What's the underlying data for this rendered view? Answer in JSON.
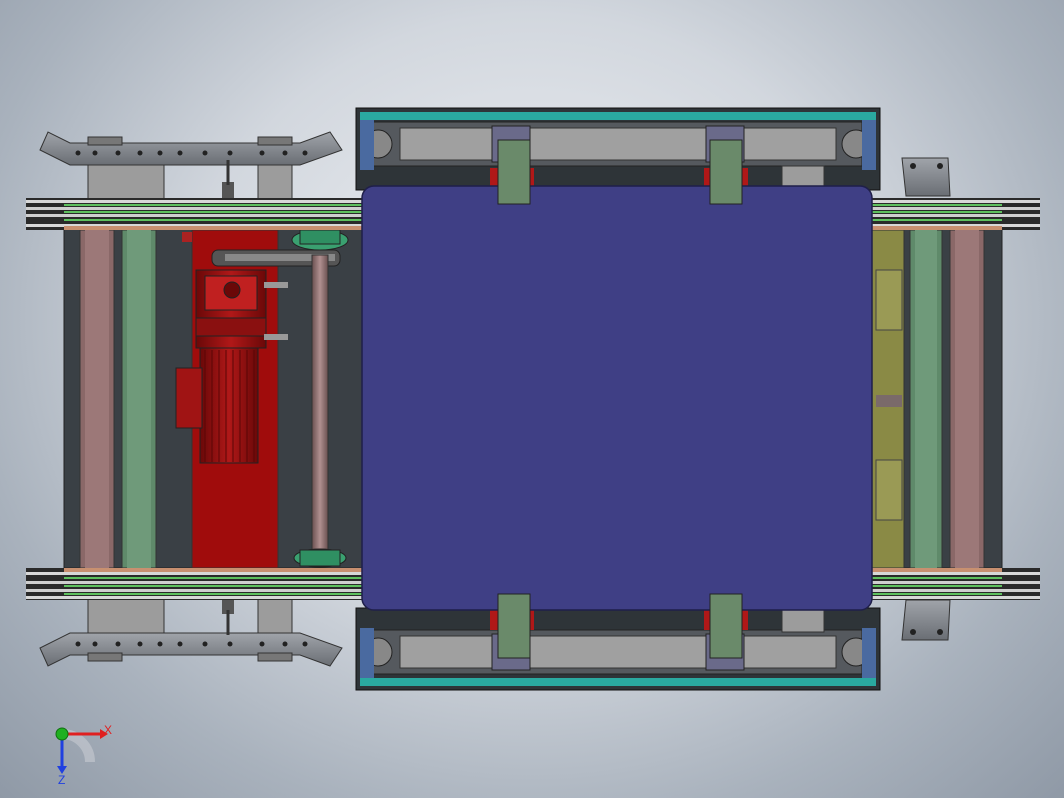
{
  "triad": {
    "x_label": "X",
    "z_label": "Z",
    "x_color": "#e02020",
    "y_color": "#20b020",
    "z_color": "#2040e0"
  },
  "colors": {
    "platform": "#3f3f85",
    "motor": "#9a0f0f",
    "gearbox": "#a01414",
    "rail_green": "#5f8a6a",
    "rail_pink": "#8a6868",
    "olive": "#8a8a45",
    "frame_dark": "#2a2a2a",
    "bracket_grey": "#8a8d92",
    "roller_grey": "#a0a0a0",
    "teal": "#2aa9a0"
  }
}
